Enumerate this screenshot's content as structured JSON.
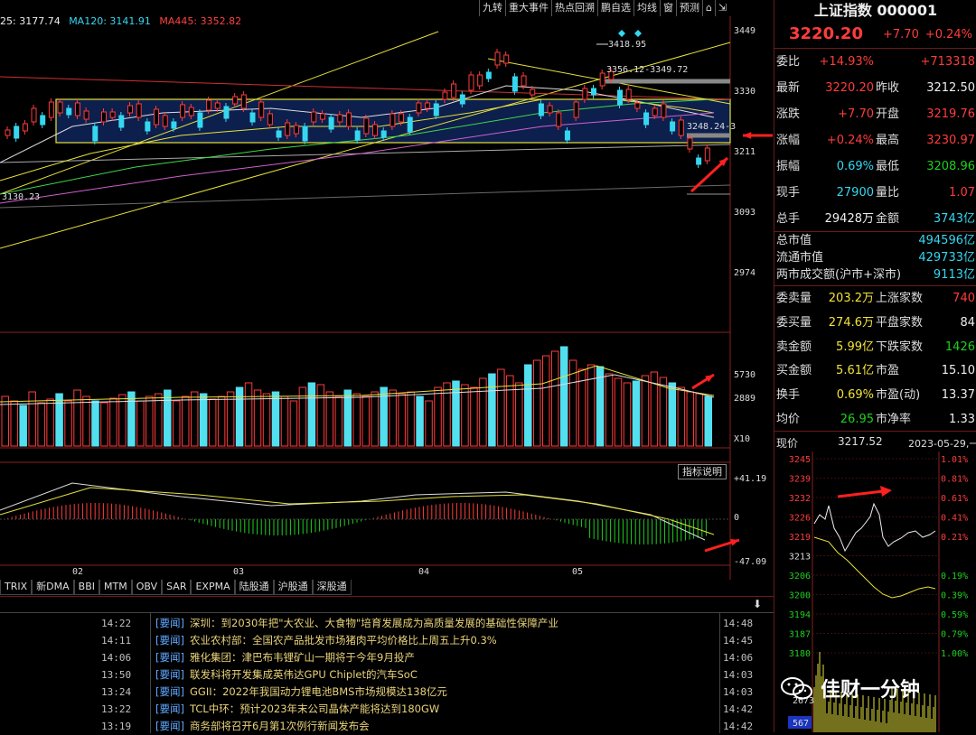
{
  "toolbar": {
    "items": [
      "九转",
      "重大事件",
      "热点回溯",
      "鹏自选",
      "均线",
      "窗",
      "预测"
    ]
  },
  "ma_legend": {
    "ma_a": "25: 3177.74",
    "ma120": "MA120: 3141.91",
    "ma445": "MA445: 3352.82"
  },
  "price_axis": [
    "3449",
    "3330",
    "3211",
    "3093",
    "2974"
  ],
  "annotations": {
    "high": "3418.95",
    "range1": "3356.12-3349.72",
    "range2": "3248.24-3",
    "low_left": "3130.23"
  },
  "volume_axis": [
    "5730",
    "2889",
    "X10"
  ],
  "macd_axis": [
    "+41.19",
    "0",
    "-47.09"
  ],
  "macd_button": "指标说明",
  "x_axis": [
    "02",
    "03",
    "04",
    "05"
  ],
  "indicator_tabs": [
    "TRIX",
    "新DMA",
    "BBI",
    "MTM",
    "OBV",
    "SAR",
    "EXPMA",
    "陆股通",
    "沪股通",
    "深股通"
  ],
  "news": [
    {
      "time1": "14:22",
      "tag": "[要闻]",
      "text": "深圳：到2030年把\"大农业、大食物\"培育发展成为高质量发展的基础性保障产业",
      "time2": "14:48"
    },
    {
      "time1": "14:11",
      "tag": "[要闻]",
      "text": "农业农村部：全国农产品批发市场猪肉平均价格比上周五上升0.3%",
      "time2": "14:45"
    },
    {
      "time1": "14:06",
      "tag": "[要闻]",
      "text": "雅化集团：津巴布韦锂矿山一期将于今年9月投产",
      "time2": "14:06"
    },
    {
      "time1": "13:50",
      "tag": "[要闻]",
      "text": "联发科将开发集成英伟达GPU Chiplet的汽车SoC",
      "time2": "14:03"
    },
    {
      "time1": "13:24",
      "tag": "[要闻]",
      "text": "GGII：2022年我国动力锂电池BMS市场规模达138亿元",
      "time2": "14:03"
    },
    {
      "time1": "13:22",
      "tag": "[要闻]",
      "text": "TCL中环：预计2023年末公司晶体产能将达到180GW",
      "time2": "14:42"
    },
    {
      "time1": "13:19",
      "tag": "[要闻]",
      "text": "商务部将召开6月第1次例行新闻发布会",
      "time2": "14:42"
    }
  ],
  "quote": {
    "title": "上证指数 000001",
    "price": "3220.20",
    "change": "+7.70",
    "pct": "+0.24%",
    "rows": [
      {
        "l": "委比",
        "v": "+14.93%",
        "vc": "red",
        "l2": "",
        "v2": "+713318",
        "v2c": "red"
      },
      {
        "l": "最新",
        "v": "3220.20",
        "vc": "red",
        "l2": "昨收",
        "v2": "3212.50",
        "v2c": "wht"
      },
      {
        "l": "涨跌",
        "v": "+7.70",
        "vc": "red",
        "l2": "开盘",
        "v2": "3219.76",
        "v2c": "red"
      },
      {
        "l": "涨幅",
        "v": "+0.24%",
        "vc": "red",
        "l2": "最高",
        "v2": "3230.97",
        "v2c": "red"
      },
      {
        "l": "振幅",
        "v": "0.69%",
        "vc": "cyn",
        "l2": "最低",
        "v2": "3208.96",
        "v2c": "grn"
      },
      {
        "l": "现手",
        "v": "27900",
        "vc": "cyn",
        "l2": "量比",
        "v2": "1.07",
        "v2c": "red"
      },
      {
        "l": "总手",
        "v": "29428万",
        "vc": "wht",
        "l2": "金额",
        "v2": "3743亿",
        "v2c": "cyn"
      }
    ],
    "market": [
      {
        "l": "总市值",
        "v": "494596亿"
      },
      {
        "l": "流通市值",
        "v": "429733亿"
      },
      {
        "l": "两市成交额(沪市+深市)",
        "v": "9113亿"
      }
    ],
    "rows2": [
      {
        "l": "委卖量",
        "v": "203.2万",
        "vc": "yel",
        "l2": "上涨家数",
        "v2": "740",
        "v2c": "red"
      },
      {
        "l": "委买量",
        "v": "274.6万",
        "vc": "yel",
        "l2": "平盘家数",
        "v2": "84",
        "v2c": "wht"
      },
      {
        "l": "卖金额",
        "v": "5.99亿",
        "vc": "yel",
        "l2": "下跌家数",
        "v2": "1426",
        "v2c": "grn"
      },
      {
        "l": "买金额",
        "v": "5.61亿",
        "vc": "yel",
        "l2": "市盈",
        "v2": "15.10",
        "v2c": "wht"
      },
      {
        "l": "换手",
        "v": "0.69%",
        "vc": "yel",
        "l2": "市盈(动)",
        "v2": "13.37",
        "v2c": "wht"
      },
      {
        "l": "均价",
        "v": "26.95",
        "vc": "grn",
        "l2": "市净率",
        "v2": "1.33",
        "v2c": "wht"
      }
    ],
    "now_label": "现价",
    "now_value": "3217.52",
    "date": "2023-05-29,一"
  },
  "intraday": {
    "left_axis": [
      "3245",
      "3239",
      "3232",
      "3226",
      "3219",
      "3213",
      "3206",
      "3200",
      "3194",
      "3187",
      "3180"
    ],
    "right_axis": [
      "1.01%",
      "0.81%",
      "0.61%",
      "0.41%",
      "0.21%",
      "",
      "0.19%",
      "0.39%",
      "0.59%",
      "0.79%",
      "1.00%"
    ],
    "vol_labels": [
      "2673",
      "567"
    ]
  },
  "watermark": "佳财一分钟"
}
